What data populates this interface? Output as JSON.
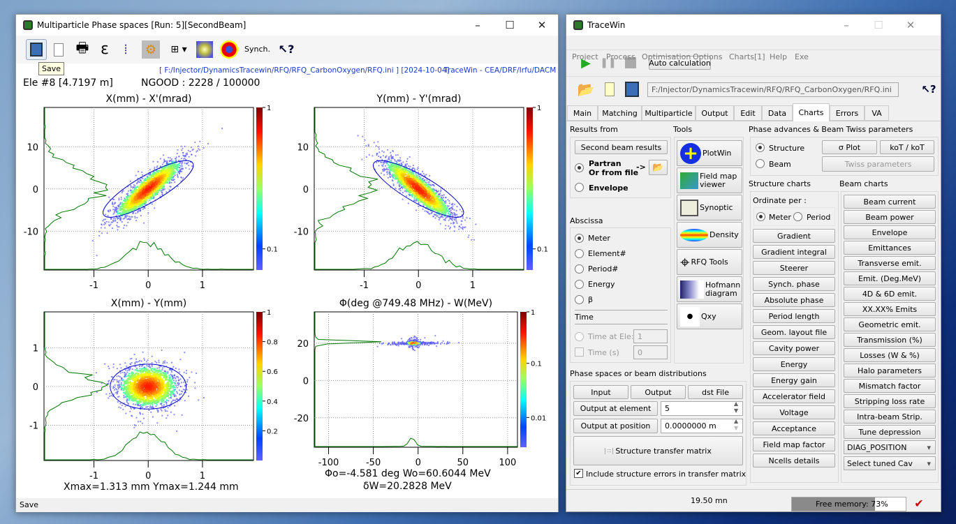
{
  "left_window": {
    "title": "Multiparticle Phase spaces [Run: 5][SecondBeam]",
    "toolbar": {
      "synch_label": "Synch.",
      "tooltip": "Save",
      "icons": [
        "save-icon",
        "copy-icon",
        "print-icon",
        "epsilon-icon",
        "ruler-icon",
        "settings-icon",
        "grid-icon",
        "density-icon",
        "target-icon",
        "help-pointer-icon"
      ]
    },
    "info_path": "[ F:/Injector/DynamicsTracewin/RFQ/RFQ_CarbonOxygen/RFQ.ini ] [2024-10-04]",
    "info_credit": "TraceWin - CEA/DRF/Irfu/DACM",
    "element_info": "Ele #8 [4.7197 m]",
    "ngood": "NGOOD : 2228 / 100000",
    "footer_xy": "Xmax=1.313 mm  Ymax=1.244 mm",
    "footer_phase": "Φo=-4.581 deg  Wo=60.6044 MeV",
    "footer_dw": "δW=20.2828 MeV",
    "status": "Save"
  },
  "chart_data": [
    {
      "type": "scatter",
      "title": "X(mm) - X'(mrad)",
      "xticks": [
        "-1",
        "0",
        "1"
      ],
      "xtick_values": [
        -1,
        0,
        1
      ],
      "yticks": [
        "10",
        "0",
        "-10"
      ],
      "ytick_values": [
        10,
        0,
        -10
      ],
      "xlim": [
        -1.92,
        1.94
      ],
      "ylim": [
        -19.2,
        19.3
      ],
      "colorbar": {
        "ticks": [
          "1",
          "0.1"
        ],
        "scale": "log"
      },
      "correlation": "positive",
      "grid": true
    },
    {
      "type": "scatter",
      "title": "Y(mm) - Y'(mrad)",
      "xticks": [
        "-1",
        "0",
        "1"
      ],
      "xtick_values": [
        -1,
        0,
        1
      ],
      "yticks": [
        "10",
        "0",
        "-10"
      ],
      "ytick_values": [
        10,
        0,
        -10
      ],
      "xlim": [
        -1.92,
        1.94
      ],
      "ylim": [
        -19.2,
        19.3
      ],
      "colorbar": {
        "ticks": [
          "1",
          "0.1"
        ],
        "scale": "log"
      },
      "correlation": "negative",
      "grid": true
    },
    {
      "type": "scatter",
      "title": "X(mm) - Y(mm)",
      "xticks": [
        "-1",
        "0",
        "1"
      ],
      "xtick_values": [
        -1,
        0,
        1
      ],
      "yticks": [
        "1",
        "0",
        "-1"
      ],
      "ytick_values": [
        1,
        0,
        -1
      ],
      "xlim": [
        -1.92,
        1.94
      ],
      "ylim": [
        -1.91,
        1.93
      ],
      "colorbar": {
        "ticks": [
          "1",
          "0.8",
          "0.6",
          "0.4",
          "0.2"
        ],
        "scale": "linear"
      },
      "correlation": "none",
      "grid": true
    },
    {
      "type": "scatter",
      "title": "Φ(deg @749.48 MHz) - W(MeV)",
      "xticks": [
        "-100",
        "-50",
        "0",
        "50",
        "100"
      ],
      "xtick_values": [
        -100,
        -50,
        0,
        50,
        100
      ],
      "yticks": [
        "20",
        "0",
        "-20"
      ],
      "ytick_values": [
        20,
        0,
        -20
      ],
      "xlim": [
        -116,
        111
      ],
      "ylim": [
        -35.8,
        36.8
      ],
      "colorbar": {
        "ticks": [
          "1",
          "0.1",
          "0.01"
        ],
        "scale": "log"
      },
      "grid": true
    }
  ],
  "right_window": {
    "title": "TraceWin",
    "menu": [
      "Project",
      "Process",
      "Optimisation",
      "Options",
      "Charts[1]",
      "Help",
      "Exe"
    ],
    "auto_calc": "Auto calculation",
    "project_path": "F:/Injector/DynamicsTracewin/RFQ/RFQ_CarbonOxygen/RFQ.ini",
    "tabs": [
      "Main",
      "Matching",
      "Multiparticle",
      "Output",
      "Edit",
      "Data",
      "Charts",
      "Errors",
      "VA"
    ],
    "active_tab": "Charts",
    "results_from": {
      "label": "Results from",
      "second_beam": "Second beam results",
      "partran_1": "Partran",
      "partran_2": "Or from file",
      "arrow": "->",
      "envelope": "Envelope"
    },
    "abscissa": {
      "label": "Abscissa",
      "options": [
        "Meter",
        "Element#",
        "Period#",
        "Energy",
        "β"
      ],
      "selected": "Meter",
      "time_label": "Time",
      "time_at_ele": "Time at Ele:",
      "time_at_ele_value": "1",
      "time_s": "Time (s)",
      "time_s_value": "0"
    },
    "tools": {
      "label": "Tools",
      "buttons": [
        "PlotWin",
        "Field map viewer",
        "Synoptic",
        "Density",
        "RFQ Tools",
        "Hofmann diagram",
        "Qxy"
      ]
    },
    "phase_spaces": {
      "label": "Phase spaces or beam distributions",
      "input": "Input",
      "output": "Output",
      "dst": "dst File",
      "output_at_element": "Output at element",
      "element_value": "5",
      "output_at_position": "Output at position",
      "position_value": "0.0000000 m",
      "transfer_matrix": "Structure transfer matrix",
      "include_errors": "Include structure errors in transfer matrix",
      "include_errors_checked": true
    },
    "twiss": {
      "label": "Phase advances & Beam Twiss parameters",
      "structure": "Structure",
      "beam": "Beam",
      "selected": "Structure",
      "sigma_plot": "σ Plot",
      "kot": "koT / koT",
      "twiss_params": "Twiss parameters"
    },
    "structure_charts": {
      "label": "Structure charts",
      "ordinate": "Ordinate per :",
      "meter": "Meter",
      "period": "Period",
      "buttons": [
        "Gradient",
        "Gradient integral",
        "Steerer",
        "Synch. phase",
        "Absolute phase",
        "Period length",
        "Geom. layout file",
        "Cavity power",
        "Energy",
        "Energy gain",
        "Accelerator field",
        "Voltage",
        "Acceptance",
        "Field map factor",
        "Ncells details"
      ]
    },
    "beam_charts": {
      "label": "Beam charts",
      "buttons": [
        "Beam current",
        "Beam power",
        "Envelope",
        "Emittances",
        "Transverse emit.",
        "Emit. (Deg.MeV)",
        "4D & 6D emit.",
        "XX.XX% Emits",
        "Geometric emit.",
        "Transmission (%)",
        "Losses (W & %)",
        "Halo parameters",
        "Mismatch factor",
        "Stripping loss rate",
        "Intra-beam Strip.",
        "Tune depression"
      ],
      "diag_combo": "DIAG_POSITION",
      "cav_combo": "Select tuned Cav"
    },
    "status": {
      "time": "19.50 mn",
      "memory_label": "Free memory: 73%",
      "memory_percent": 73
    }
  }
}
